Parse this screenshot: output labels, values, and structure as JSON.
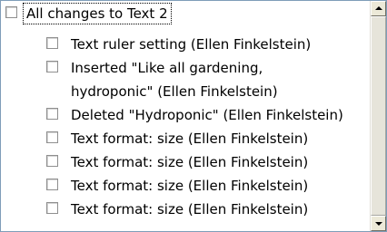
{
  "changes_list": {
    "header": {
      "label": "All changes to Text 2",
      "checked": false
    },
    "items": [
      {
        "label": "Text ruler setting (Ellen Finkelstein)",
        "checked": false
      },
      {
        "label": "Inserted \"Like all gardening,",
        "continuation": "hydroponic\" (Ellen Finkelstein)",
        "checked": false
      },
      {
        "label": "Deleted \"Hydroponic\" (Ellen Finkelstein)",
        "checked": false
      },
      {
        "label": "Text format: size (Ellen Finkelstein)",
        "checked": false
      },
      {
        "label": "Text format: size (Ellen Finkelstein)",
        "checked": false
      },
      {
        "label": "Text format: size (Ellen Finkelstein)",
        "checked": false
      },
      {
        "label": "Text format: size (Ellen Finkelstein)",
        "checked": false
      }
    ]
  },
  "icons": {
    "scroll_up": "scroll-up-arrow-icon",
    "scroll_down": "scroll-down-arrow-icon"
  }
}
